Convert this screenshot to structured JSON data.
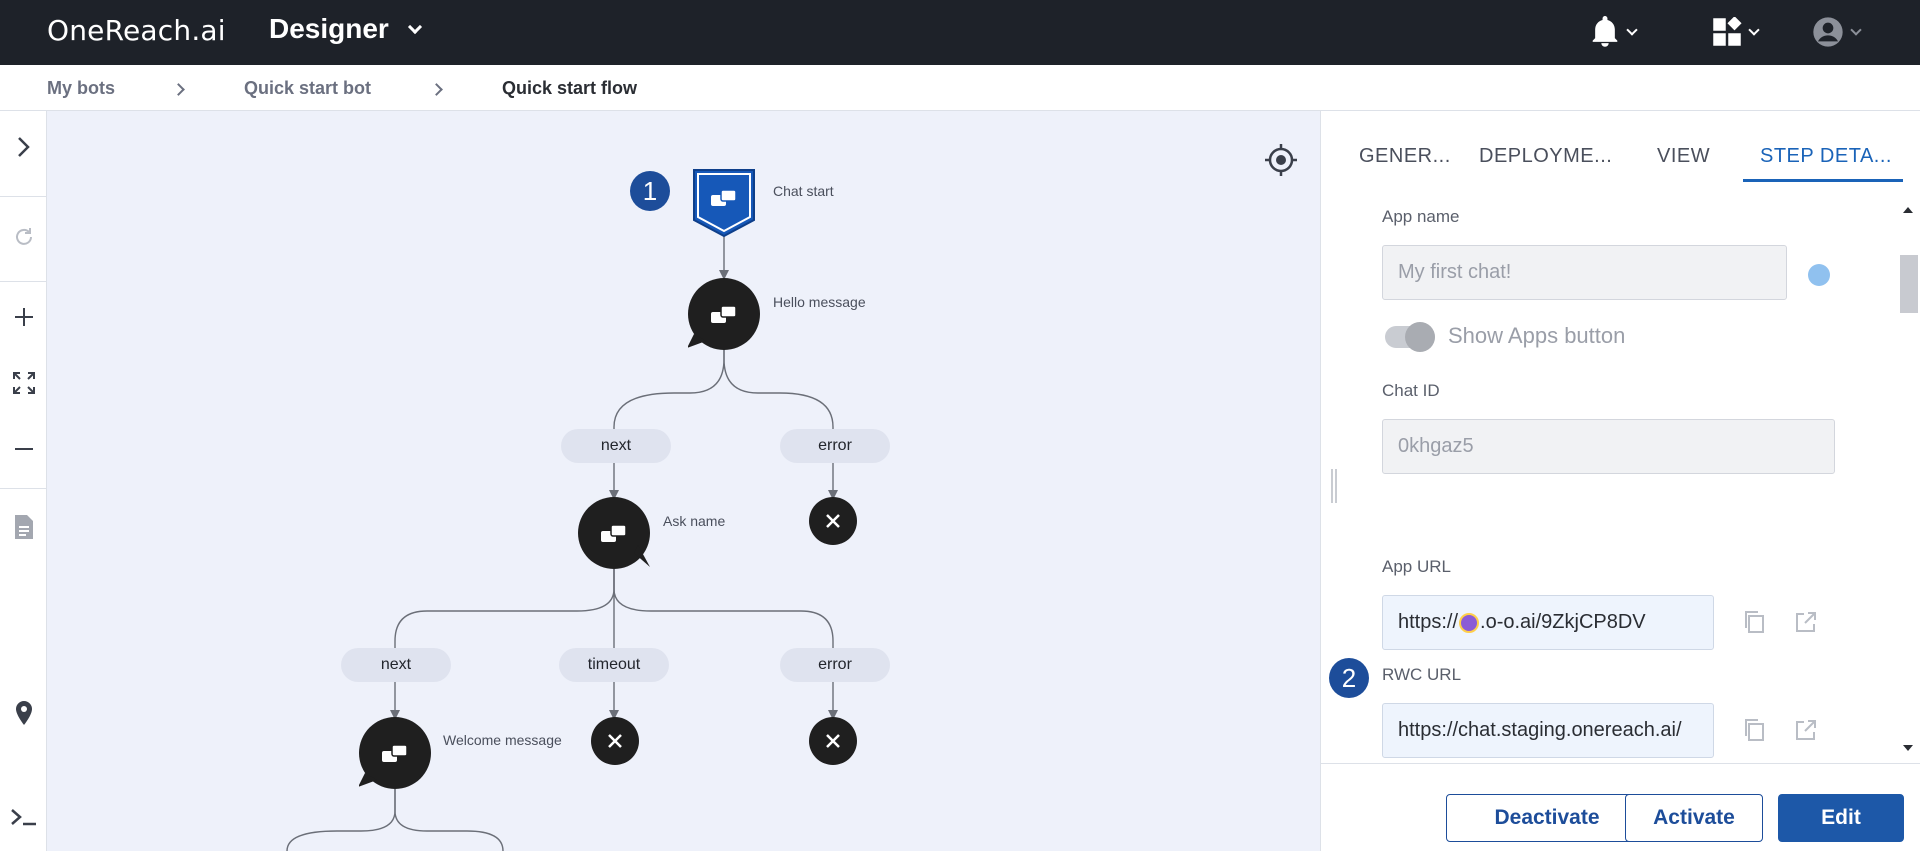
{
  "topbar": {
    "logo": "OneReach.ai",
    "app_title": "Designer"
  },
  "breadcrumb": [
    "My bots",
    "Quick start bot",
    "Quick start flow"
  ],
  "flow": {
    "nodes": {
      "chat_start": "Chat start",
      "hello": "Hello message",
      "ask_name": "Ask name",
      "welcome": "Welcome message"
    },
    "ports": {
      "hello_next": "next",
      "hello_error": "error",
      "ask_next": "next",
      "ask_timeout": "timeout",
      "ask_error": "error"
    },
    "badge_1": "1"
  },
  "panel": {
    "tabs": [
      "GENER...",
      "DEPLOYME...",
      "VIEW",
      "STEP DETA..."
    ],
    "active_tab": 3,
    "app_name_label": "App name",
    "app_name_value": "My first chat!",
    "show_apps_label": "Show Apps button",
    "chat_id_label": "Chat ID",
    "chat_id_value": "0khgaz5",
    "app_url_label": "App URL",
    "app_url_prefix": "https://",
    "app_url_suffix": ".o-o.ai/9ZkjCP8DV",
    "rwc_url_label": "RWC URL",
    "rwc_url_value": "https://chat.staging.onereach.ai/",
    "badge_2": "2",
    "buttons": {
      "deactivate": "Deactivate",
      "activate": "Activate",
      "edit": "Edit"
    }
  },
  "colors": {
    "topbar": "#1e2229",
    "accent": "#1d58a8",
    "canvas": "#eef1fa"
  }
}
